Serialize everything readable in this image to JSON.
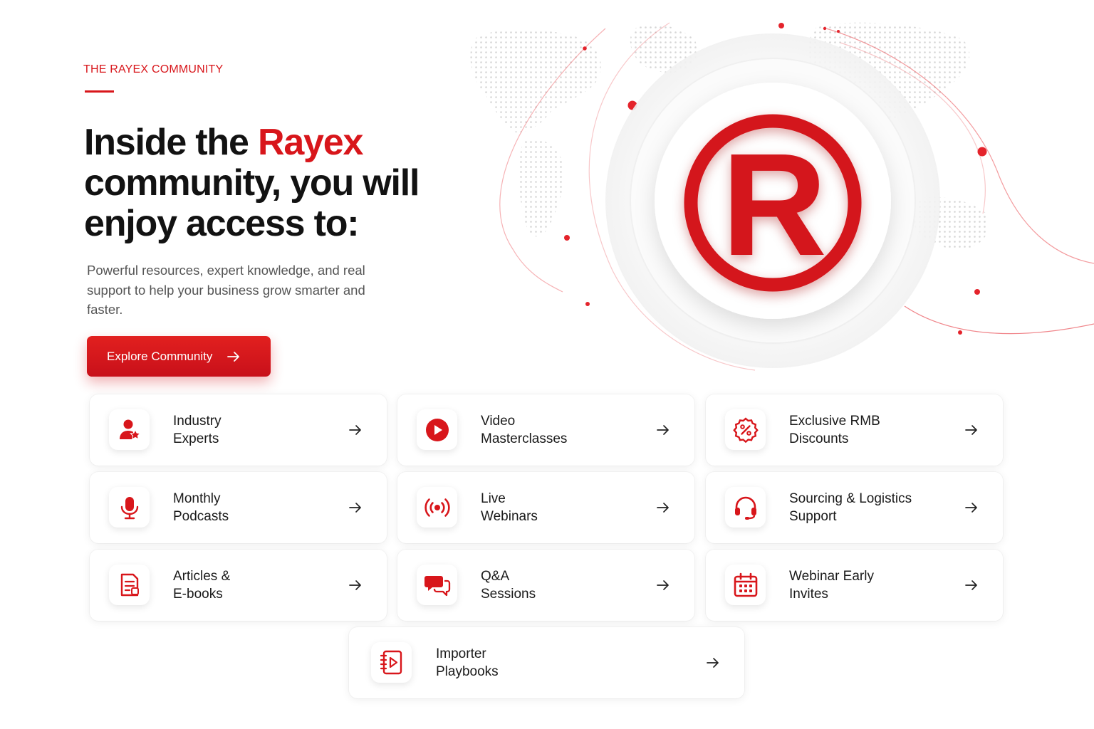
{
  "hero": {
    "eyebrow": "THE RAYEX COMMUNITY",
    "headline_prefix": "Inside the ",
    "headline_accent": "Rayex",
    "headline_suffix": " community, you will enjoy access to:",
    "subtext": "Powerful resources, expert knowledge, and real support to help your business grow smarter and faster.",
    "cta_label": "Explore Community"
  },
  "logo": {
    "letter": "R"
  },
  "colors": {
    "brand": "#d8161b",
    "text": "#141414",
    "muted": "#555555"
  },
  "benefits": [
    {
      "label": "Industry\nExperts",
      "icon": "expert-user-icon"
    },
    {
      "label": "Video\nMasterclasses",
      "icon": "play-icon"
    },
    {
      "label": "Exclusive RMB\nDiscounts",
      "icon": "discount-badge-icon"
    },
    {
      "label": "Monthly\nPodcasts",
      "icon": "microphone-icon"
    },
    {
      "label": "Live\nWebinars",
      "icon": "broadcast-icon"
    },
    {
      "label": "Sourcing & Logistics\nSupport",
      "icon": "headset-icon"
    },
    {
      "label": "Articles &\nE-books",
      "icon": "document-icon"
    },
    {
      "label": "Q&A\nSessions",
      "icon": "chat-icon"
    },
    {
      "label": "Webinar Early\nInvites",
      "icon": "calendar-icon"
    },
    {
      "label": "Importer\nPlaybooks",
      "icon": "playbook-icon"
    }
  ]
}
